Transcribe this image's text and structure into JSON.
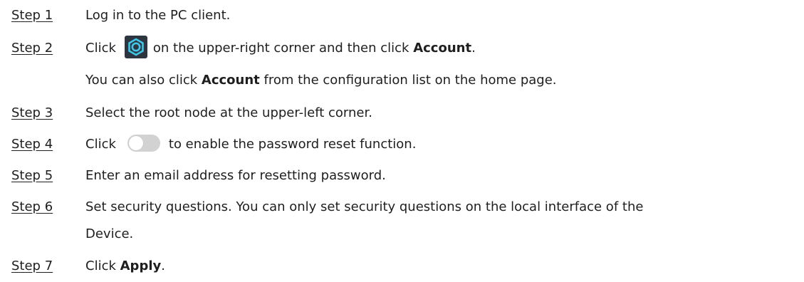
{
  "steps": [
    {
      "label": "Step 1",
      "text": "Log in to the PC client."
    },
    {
      "label": "Step 2",
      "pre": "Click",
      "icon": "gear-icon",
      "mid": "on the upper-right corner and then click",
      "bold": "Account",
      "post": ".",
      "continuation_pre": "You can also click",
      "continuation_bold": "Account",
      "continuation_post": "from the configuration list on the home page."
    },
    {
      "label": "Step 3",
      "text": "Select the root node at the upper-left corner."
    },
    {
      "label": "Step 4",
      "pre": "Click",
      "icon": "toggle-switch-icon",
      "post": "to enable the password reset function."
    },
    {
      "label": "Step 5",
      "text": "Enter an email address for resetting password."
    },
    {
      "label": "Step 6",
      "line1": "Set security questions. You can only set security questions on the local interface of the",
      "line2": "Device."
    },
    {
      "label": "Step 7",
      "pre": "Click",
      "bold": "Apply",
      "post": "."
    }
  ],
  "colors": {
    "text": "#1e1e1e",
    "gear_bg": "#2d3540",
    "gear_accent": "#3fc6e8",
    "toggle_bg": "#d2d2d2"
  }
}
